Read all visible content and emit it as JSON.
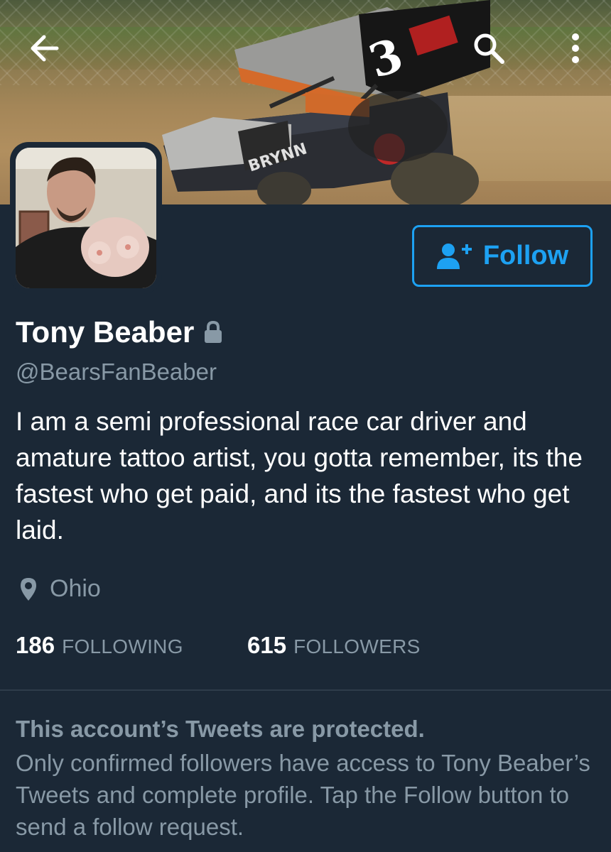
{
  "header": {
    "back_icon": "arrow-left-icon",
    "search_icon": "search-icon",
    "more_icon": "more-vertical-icon"
  },
  "follow_button": {
    "icon": "add-user-icon",
    "label": "Follow"
  },
  "profile": {
    "name": "Tony Beaber",
    "lock_icon": "lock-icon",
    "handle": "@BearsFanBeaber",
    "bio": "I am a semi professional race car driver and amature tattoo artist, you gotta remember, its the fastest who get paid, and its the fastest who get laid.",
    "location_icon": "location-pin-icon",
    "location": "Ohio"
  },
  "stats": {
    "following_count": "186",
    "following_label": "FOLLOWING",
    "followers_count": "615",
    "followers_label": "FOLLOWERS"
  },
  "protected_notice": {
    "title": "This account’s Tweets are protected.",
    "body": "Only confirmed followers have access to Tony Beaber’s Tweets and complete profile. Tap the Follow button to send a follow request."
  },
  "colors": {
    "background": "#1b2836",
    "accent": "#1da1f2",
    "secondary_text": "#8899a6",
    "primary_text": "#ffffff"
  }
}
